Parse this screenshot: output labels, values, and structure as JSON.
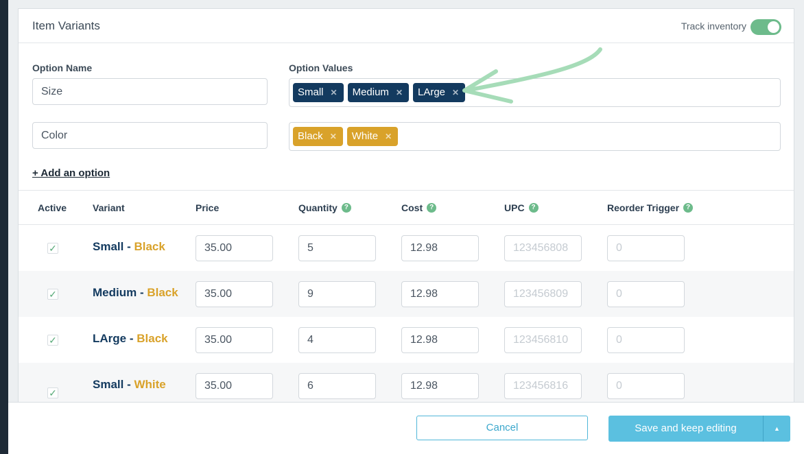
{
  "header": {
    "title": "Item Variants",
    "track_inventory_label": "Track inventory",
    "track_inventory_on": true
  },
  "options": {
    "name_label": "Option Name",
    "values_label": "Option Values",
    "rows": [
      {
        "name": "Size",
        "values": [
          "Small",
          "Medium",
          "LArge"
        ]
      },
      {
        "name": "Color",
        "values": [
          "Black",
          "White"
        ]
      }
    ],
    "add_option_label": "+ Add an option"
  },
  "table": {
    "headers": {
      "active": "Active",
      "variant": "Variant",
      "price": "Price",
      "quantity": "Quantity",
      "cost": "Cost",
      "upc": "UPC",
      "reorder": "Reorder Trigger"
    },
    "help_glyph": "?",
    "check_glyph": "✓",
    "separator": " - ",
    "rows": [
      {
        "size": "Small",
        "color": "Black",
        "price": "35.00",
        "quantity": "5",
        "cost": "12.98",
        "upc_placeholder": "123456808",
        "reorder_placeholder": "0"
      },
      {
        "size": "Medium",
        "color": "Black",
        "price": "35.00",
        "quantity": "9",
        "cost": "12.98",
        "upc_placeholder": "123456809",
        "reorder_placeholder": "0"
      },
      {
        "size": "LArge",
        "color": "Black",
        "price": "35.00",
        "quantity": "4",
        "cost": "12.98",
        "upc_placeholder": "123456810",
        "reorder_placeholder": "0"
      },
      {
        "size": "Small",
        "color": "White",
        "price": "35.00",
        "quantity": "6",
        "cost": "12.98",
        "upc_placeholder": "123456816",
        "reorder_placeholder": "0"
      }
    ]
  },
  "footer": {
    "cancel_label": "Cancel",
    "save_label": "Save and keep editing"
  },
  "icons": {
    "remove_tag": "close-icon",
    "save_dropdown": "caret-up-icon",
    "help": "question-circle-icon",
    "check": "checkmark-icon"
  },
  "colors": {
    "size_tag": "#133a5f",
    "color_tag": "#d9a22a",
    "accent_green": "#6dbb8b",
    "primary_button": "#5bc0e0",
    "annotation_arrow": "#a6dcb8"
  }
}
